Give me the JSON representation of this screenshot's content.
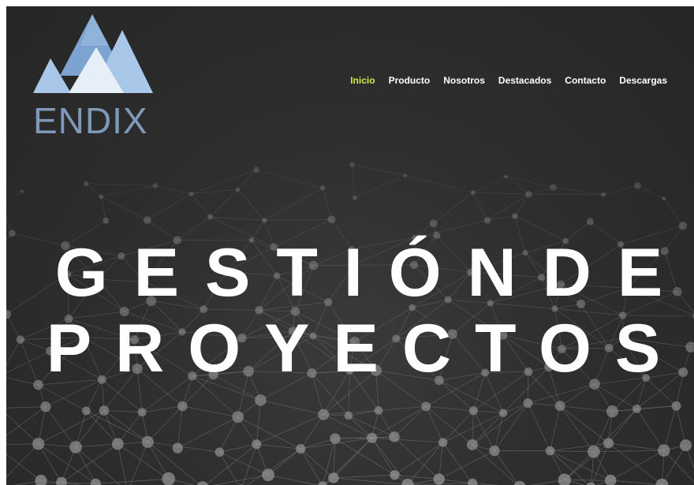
{
  "logo": {
    "text": "ENDIX",
    "colors": {
      "mountain_dark": "#7da3d0",
      "mountain_light": "#a9c7e8",
      "mountain_pale": "#e6eef8",
      "text": "#7f9ab8"
    }
  },
  "nav": {
    "items": [
      {
        "label": "Inicio",
        "active": true
      },
      {
        "label": "Producto",
        "active": false
      },
      {
        "label": "Nosotros",
        "active": false
      },
      {
        "label": "Destacados",
        "active": false
      },
      {
        "label": "Contacto",
        "active": false
      },
      {
        "label": "Descargas",
        "active": false
      }
    ],
    "active_color": "#d7e64a"
  },
  "hero": {
    "line1": "GESTIÓNDE",
    "line2": "PROYECTOS"
  },
  "background": {
    "pattern": "network-mesh",
    "color": "#2e2e2e"
  }
}
